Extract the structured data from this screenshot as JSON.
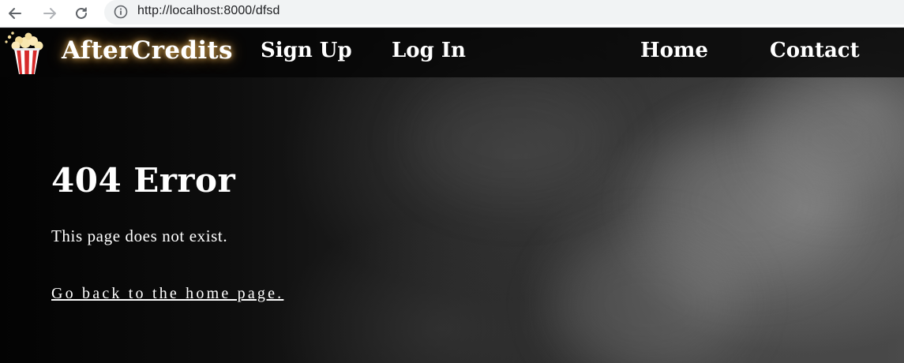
{
  "browser": {
    "url": "http://localhost:8000/dfsd",
    "icons": [
      "back-arrow-icon",
      "forward-arrow-icon",
      "reload-icon",
      "info-icon"
    ]
  },
  "navbar": {
    "brand": "AfterCredits",
    "brand_icon": "popcorn-icon",
    "links": {
      "signup": "Sign Up",
      "login": "Log In",
      "home": "Home",
      "contact": "Contact"
    }
  },
  "main": {
    "title": "404 Error",
    "message": "This page does not exist.",
    "home_link": "Go back to the home page."
  },
  "colors": {
    "text": "#ffffff",
    "navbar_bg": "#050505",
    "brand_glow": "#ffb347",
    "popcorn_red": "#d62b2b",
    "popcorn_kernel": "#f7e7b0"
  }
}
